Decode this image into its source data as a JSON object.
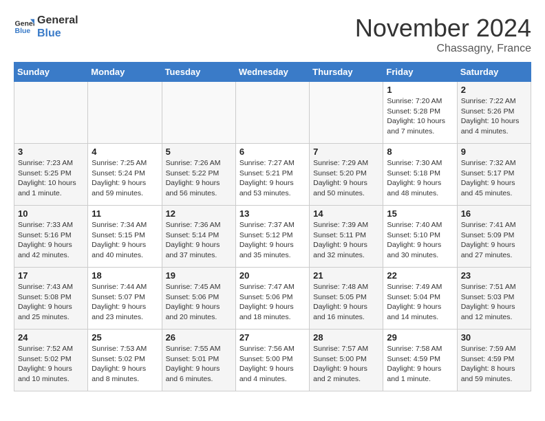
{
  "logo": {
    "line1": "General",
    "line2": "Blue"
  },
  "title": "November 2024",
  "location": "Chassagny, France",
  "weekdays": [
    "Sunday",
    "Monday",
    "Tuesday",
    "Wednesday",
    "Thursday",
    "Friday",
    "Saturday"
  ],
  "weeks": [
    [
      {
        "day": "",
        "info": ""
      },
      {
        "day": "",
        "info": ""
      },
      {
        "day": "",
        "info": ""
      },
      {
        "day": "",
        "info": ""
      },
      {
        "day": "",
        "info": ""
      },
      {
        "day": "1",
        "info": "Sunrise: 7:20 AM\nSunset: 5:28 PM\nDaylight: 10 hours and 7 minutes."
      },
      {
        "day": "2",
        "info": "Sunrise: 7:22 AM\nSunset: 5:26 PM\nDaylight: 10 hours and 4 minutes."
      }
    ],
    [
      {
        "day": "3",
        "info": "Sunrise: 7:23 AM\nSunset: 5:25 PM\nDaylight: 10 hours and 1 minute."
      },
      {
        "day": "4",
        "info": "Sunrise: 7:25 AM\nSunset: 5:24 PM\nDaylight: 9 hours and 59 minutes."
      },
      {
        "day": "5",
        "info": "Sunrise: 7:26 AM\nSunset: 5:22 PM\nDaylight: 9 hours and 56 minutes."
      },
      {
        "day": "6",
        "info": "Sunrise: 7:27 AM\nSunset: 5:21 PM\nDaylight: 9 hours and 53 minutes."
      },
      {
        "day": "7",
        "info": "Sunrise: 7:29 AM\nSunset: 5:20 PM\nDaylight: 9 hours and 50 minutes."
      },
      {
        "day": "8",
        "info": "Sunrise: 7:30 AM\nSunset: 5:18 PM\nDaylight: 9 hours and 48 minutes."
      },
      {
        "day": "9",
        "info": "Sunrise: 7:32 AM\nSunset: 5:17 PM\nDaylight: 9 hours and 45 minutes."
      }
    ],
    [
      {
        "day": "10",
        "info": "Sunrise: 7:33 AM\nSunset: 5:16 PM\nDaylight: 9 hours and 42 minutes."
      },
      {
        "day": "11",
        "info": "Sunrise: 7:34 AM\nSunset: 5:15 PM\nDaylight: 9 hours and 40 minutes."
      },
      {
        "day": "12",
        "info": "Sunrise: 7:36 AM\nSunset: 5:14 PM\nDaylight: 9 hours and 37 minutes."
      },
      {
        "day": "13",
        "info": "Sunrise: 7:37 AM\nSunset: 5:12 PM\nDaylight: 9 hours and 35 minutes."
      },
      {
        "day": "14",
        "info": "Sunrise: 7:39 AM\nSunset: 5:11 PM\nDaylight: 9 hours and 32 minutes."
      },
      {
        "day": "15",
        "info": "Sunrise: 7:40 AM\nSunset: 5:10 PM\nDaylight: 9 hours and 30 minutes."
      },
      {
        "day": "16",
        "info": "Sunrise: 7:41 AM\nSunset: 5:09 PM\nDaylight: 9 hours and 27 minutes."
      }
    ],
    [
      {
        "day": "17",
        "info": "Sunrise: 7:43 AM\nSunset: 5:08 PM\nDaylight: 9 hours and 25 minutes."
      },
      {
        "day": "18",
        "info": "Sunrise: 7:44 AM\nSunset: 5:07 PM\nDaylight: 9 hours and 23 minutes."
      },
      {
        "day": "19",
        "info": "Sunrise: 7:45 AM\nSunset: 5:06 PM\nDaylight: 9 hours and 20 minutes."
      },
      {
        "day": "20",
        "info": "Sunrise: 7:47 AM\nSunset: 5:06 PM\nDaylight: 9 hours and 18 minutes."
      },
      {
        "day": "21",
        "info": "Sunrise: 7:48 AM\nSunset: 5:05 PM\nDaylight: 9 hours and 16 minutes."
      },
      {
        "day": "22",
        "info": "Sunrise: 7:49 AM\nSunset: 5:04 PM\nDaylight: 9 hours and 14 minutes."
      },
      {
        "day": "23",
        "info": "Sunrise: 7:51 AM\nSunset: 5:03 PM\nDaylight: 9 hours and 12 minutes."
      }
    ],
    [
      {
        "day": "24",
        "info": "Sunrise: 7:52 AM\nSunset: 5:02 PM\nDaylight: 9 hours and 10 minutes."
      },
      {
        "day": "25",
        "info": "Sunrise: 7:53 AM\nSunset: 5:02 PM\nDaylight: 9 hours and 8 minutes."
      },
      {
        "day": "26",
        "info": "Sunrise: 7:55 AM\nSunset: 5:01 PM\nDaylight: 9 hours and 6 minutes."
      },
      {
        "day": "27",
        "info": "Sunrise: 7:56 AM\nSunset: 5:00 PM\nDaylight: 9 hours and 4 minutes."
      },
      {
        "day": "28",
        "info": "Sunrise: 7:57 AM\nSunset: 5:00 PM\nDaylight: 9 hours and 2 minutes."
      },
      {
        "day": "29",
        "info": "Sunrise: 7:58 AM\nSunset: 4:59 PM\nDaylight: 9 hours and 1 minute."
      },
      {
        "day": "30",
        "info": "Sunrise: 7:59 AM\nSunset: 4:59 PM\nDaylight: 8 hours and 59 minutes."
      }
    ]
  ]
}
